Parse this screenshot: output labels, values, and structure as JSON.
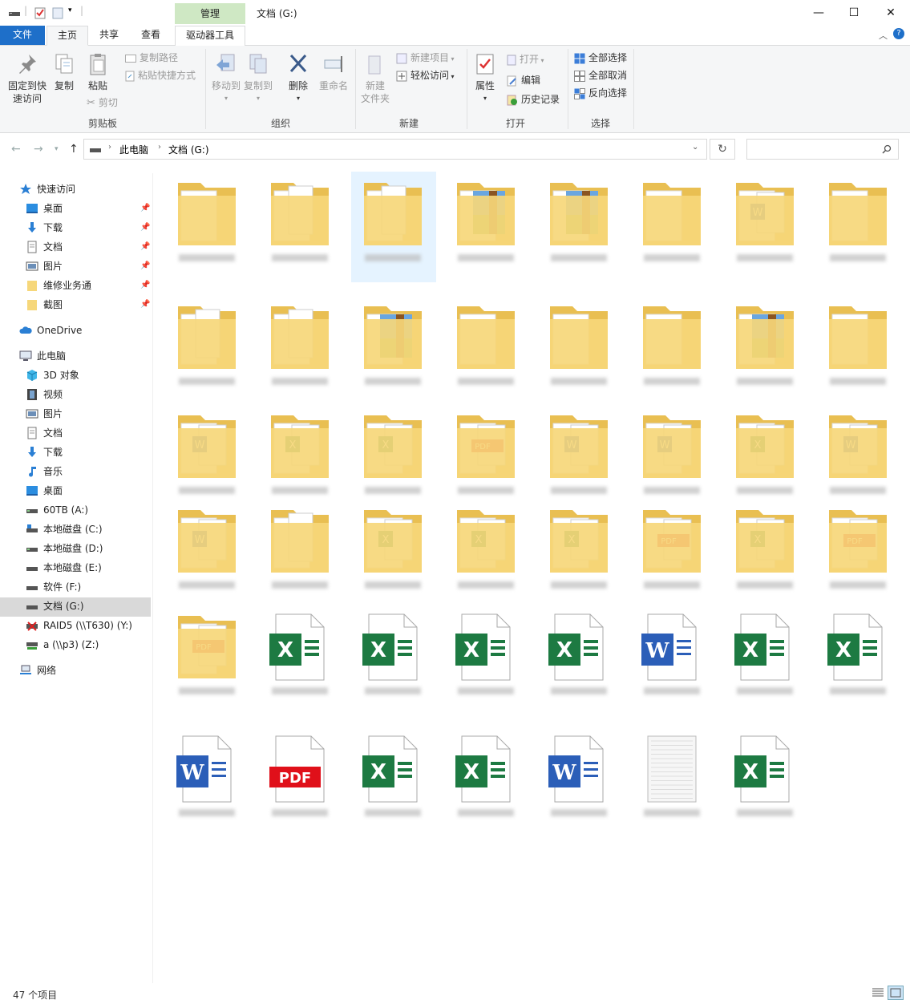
{
  "titlebar": {
    "context_tab": "管理",
    "window_title": "文档 (G:)",
    "minimize": "—",
    "maximize": "☐",
    "close": "✕"
  },
  "ribbon_tabs": {
    "file": "文件",
    "home": "主页",
    "share": "共享",
    "view": "查看",
    "drive_tools": "驱动器工具"
  },
  "ribbon": {
    "pin_label_1": "固定到快",
    "pin_label_2": "速访问",
    "copy": "复制",
    "paste": "粘贴",
    "copy_path": "复制路径",
    "paste_shortcut": "粘贴快捷方式",
    "cut": "剪切",
    "group_clipboard": "剪贴板",
    "move_to": "移动到",
    "copy_to": "复制到",
    "delete": "删除",
    "rename": "重命名",
    "group_organize": "组织",
    "new_folder_1": "新建",
    "new_folder_2": "文件夹",
    "new_item": "新建项目",
    "easy_access": "轻松访问",
    "group_new": "新建",
    "properties": "属性",
    "open": "打开",
    "edit": "编辑",
    "history": "历史记录",
    "group_open": "打开",
    "select_all": "全部选择",
    "select_none": "全部取消",
    "invert_selection": "反向选择",
    "group_select": "选择"
  },
  "address": {
    "crumb_1": "此电脑",
    "crumb_2": "文档 (G:)",
    "search_placeholder": ""
  },
  "sidebar": {
    "quick_access": "快速访问",
    "qa_desktop": "桌面",
    "qa_downloads": "下载",
    "qa_documents": "文档",
    "qa_pictures": "图片",
    "qa_repair": "维修业务通",
    "qa_screenshots": "截图",
    "onedrive": "OneDrive",
    "this_pc": "此电脑",
    "pc_3d": "3D 对象",
    "pc_videos": "视频",
    "pc_pictures": "图片",
    "pc_documents": "文档",
    "pc_downloads": "下载",
    "pc_music": "音乐",
    "pc_desktop": "桌面",
    "drive_a": "60TB (A:)",
    "drive_c": "本地磁盘 (C:)",
    "drive_d": "本地磁盘 (D:)",
    "drive_e": "本地磁盘 (E:)",
    "drive_f": "软件 (F:)",
    "drive_g": "文档 (G:)",
    "drive_y": "RAID5 (\\\\T630) (Y:)",
    "drive_z": "a (\\\\p3) (Z:)",
    "network": "网络"
  },
  "status": {
    "item_count": "47 个项目"
  },
  "colors": {
    "accent": "#1e6fc9",
    "context_tab": "#cfe8c4",
    "folder": "#f6d77a",
    "excel": "#1d7a42",
    "word": "#2b5eb8",
    "pdf": "#e0101a"
  }
}
